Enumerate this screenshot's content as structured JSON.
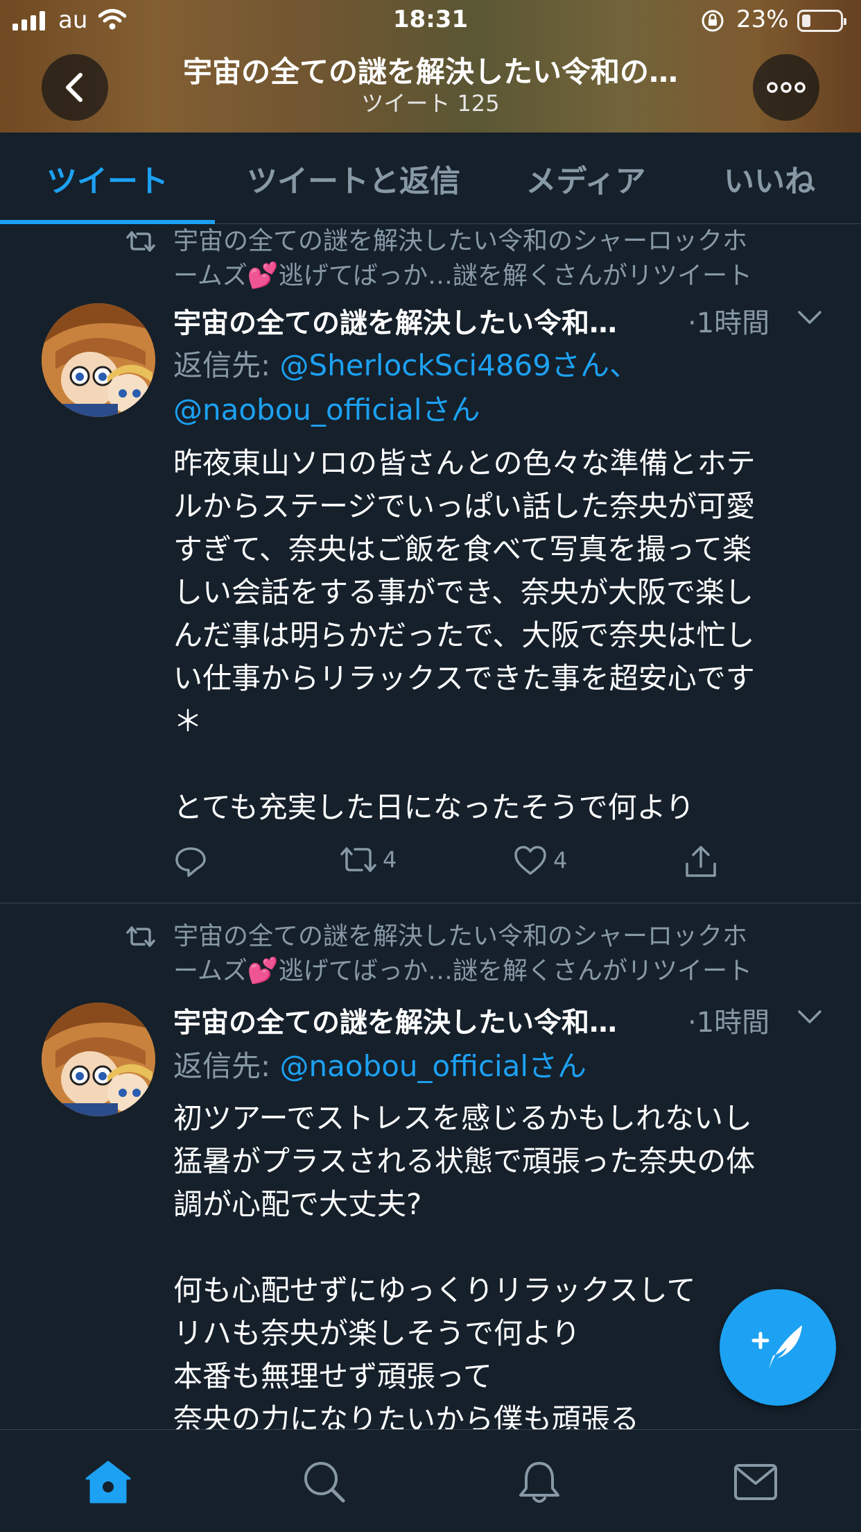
{
  "status_bar": {
    "carrier": "au",
    "time": "18:31",
    "battery_percent": "23%",
    "battery_level": 0.23
  },
  "profile_header": {
    "title": "宇宙の全ての謎を解決したい令和の…",
    "tweet_count": "ツイート 125"
  },
  "tabs": [
    {
      "label": "ツイート",
      "active": true
    },
    {
      "label": "ツイートと返信",
      "active": false
    },
    {
      "label": "メディア",
      "active": false
    },
    {
      "label": "いいね",
      "active": false
    }
  ],
  "tweets": [
    {
      "retweet_line1": "宇宙の全ての謎を解決したい令和のシャーロックホ",
      "retweet_line2_pre": "ームズ",
      "retweet_emoji": "💕",
      "retweet_line2_post": "逃げてばっか…謎を解くさんがリツイート",
      "name": "宇宙の全ての謎を解決したい令和…",
      "time": "·1時間",
      "reply_prefix": "返信先: ",
      "reply_mention1": "@SherlockSci4869さん、",
      "reply_mention2": "@naobou_officialさん",
      "body": "昨夜東山ソロの皆さんとの色々な準備とホテ\nルからステージでいっぱい話した奈央が可愛\nすぎて、奈央はご飯を食べて写真を撮って楽\nしい会話をする事ができ、奈央が大阪で楽し\nんだ事は明らかだったで、大阪で奈央は忙し\nい仕事からリラックスできた事を超安心です\n＊\n\nとても充実した日になったそうで何より",
      "retweets": "4",
      "likes": "4"
    },
    {
      "retweet_line1": "宇宙の全ての謎を解決したい令和のシャーロックホ",
      "retweet_line2_pre": "ームズ",
      "retweet_emoji": "💕",
      "retweet_line2_post": "逃げてばっか…謎を解くさんがリツイート",
      "name": "宇宙の全ての謎を解決したい令和…",
      "time": "·1時間",
      "reply_prefix": "返信先: ",
      "reply_mention1": "@naobou_officialさん",
      "body": "初ツアーでストレスを感じるかもしれないし\n猛暑がプラスされる状態で頑張った奈央の体\n調が心配で大丈夫?\n\n何も心配せずにゆっくりリラックスして\nリハも奈央が楽しそうで何より\n本番も無理せず頑張って\n奈央の力になりたいから僕も頑張る"
    }
  ],
  "icons": {
    "back": "chevron-left-icon",
    "more": "more-horizontal-icon",
    "retweet": "retweet-icon",
    "caret": "chevron-down-icon",
    "reply": "reply-icon",
    "like": "heart-icon",
    "share": "share-icon",
    "compose": "compose-tweet-icon",
    "home": "home-icon",
    "search": "search-icon",
    "notifications": "bell-icon",
    "messages": "mail-icon"
  },
  "colors": {
    "background": "#15202b",
    "accent": "#1da1f2",
    "secondary_text": "#8899a6",
    "divider": "#38444d"
  }
}
